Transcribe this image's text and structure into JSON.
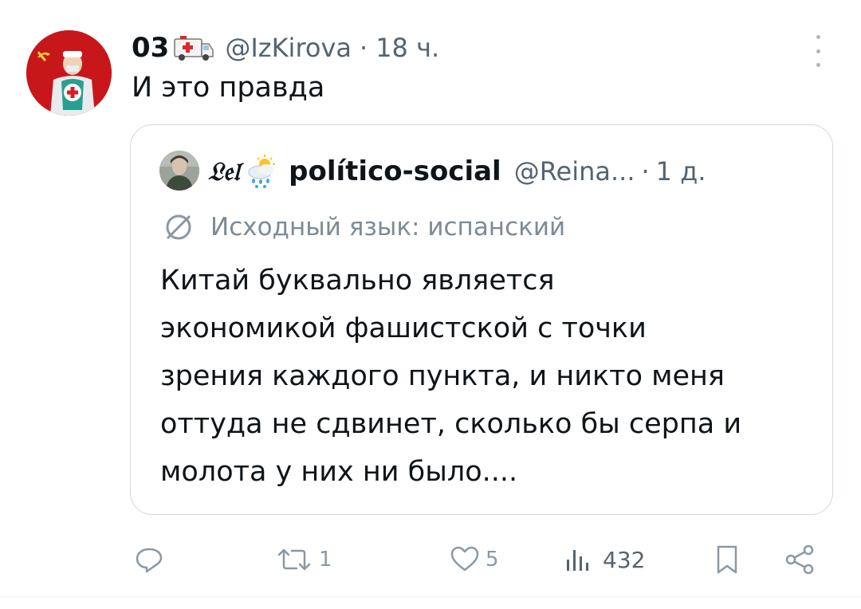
{
  "tweet": {
    "author_name": "03",
    "author_emoji": "ambulance-emoji",
    "handle": "@IzKirova",
    "separator": "·",
    "time": "18 ч.",
    "text": "И это правда",
    "more_icon": "more-vertical-icon"
  },
  "quote": {
    "name_prefix": "𝔏𝔢𝔩",
    "name_emoji": "cloud-rain-sun-emoji",
    "name": "político-social",
    "handle": "@Reina...",
    "separator": "·",
    "time": "1 д.",
    "translation_label": "Исходный язык: испанский",
    "text_lines": [
      "Китай буквально является",
      "экономикой фашистской с точки",
      "зрения каждого пункта, и никто меня",
      "оттуда не сдвинет, сколько бы серпа и",
      "молота у них ни было...."
    ]
  },
  "actions": {
    "reply_count": "",
    "retweet_count": "1",
    "like_count": "5",
    "views_count": "432"
  },
  "colors": {
    "secondary_text": "#536471",
    "icon_gray": "#8a98a4",
    "border": "#cfd9de",
    "avatar_bg": "#c8171b"
  }
}
